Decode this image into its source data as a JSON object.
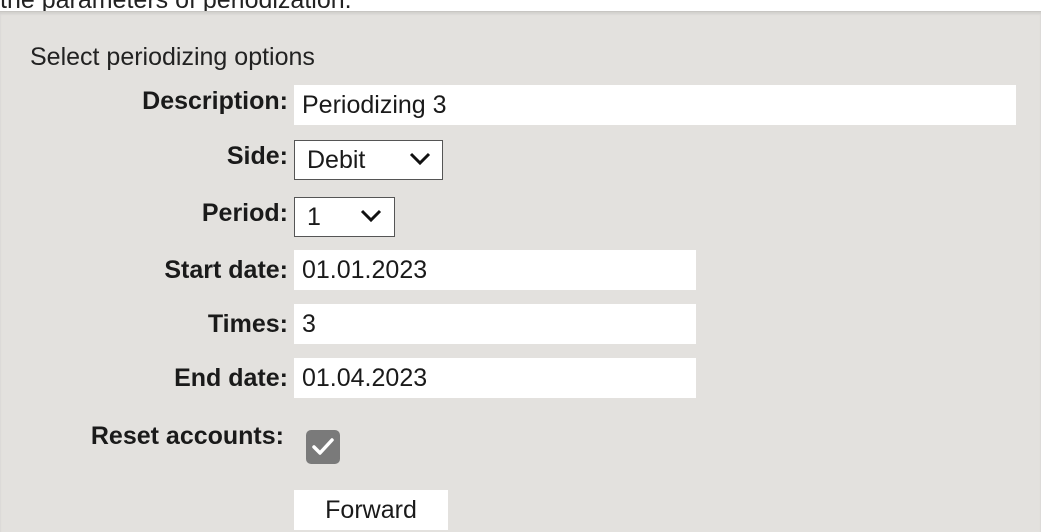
{
  "header": {
    "intro_text": "the parameters of periodization."
  },
  "form": {
    "title": "Select periodizing options",
    "description": {
      "label": "Description:",
      "value": "Periodizing 3"
    },
    "side": {
      "label": "Side:",
      "value": "Debit"
    },
    "period": {
      "label": "Period:",
      "value": "1"
    },
    "start_date": {
      "label": "Start date:",
      "value": "01.01.2023"
    },
    "times": {
      "label": "Times:",
      "value": "3"
    },
    "end_date": {
      "label": "End date:",
      "value": "01.04.2023"
    },
    "reset_accounts": {
      "label": "Reset accounts:",
      "checked": true
    },
    "forward_button": "Forward"
  },
  "icons": {
    "dropdown": "chevron-down-icon",
    "check": "check-icon"
  },
  "colors": {
    "panel_background": "#e3e1de",
    "field_background": "#ffffff",
    "checkbox_fill": "#7a7a7a"
  }
}
